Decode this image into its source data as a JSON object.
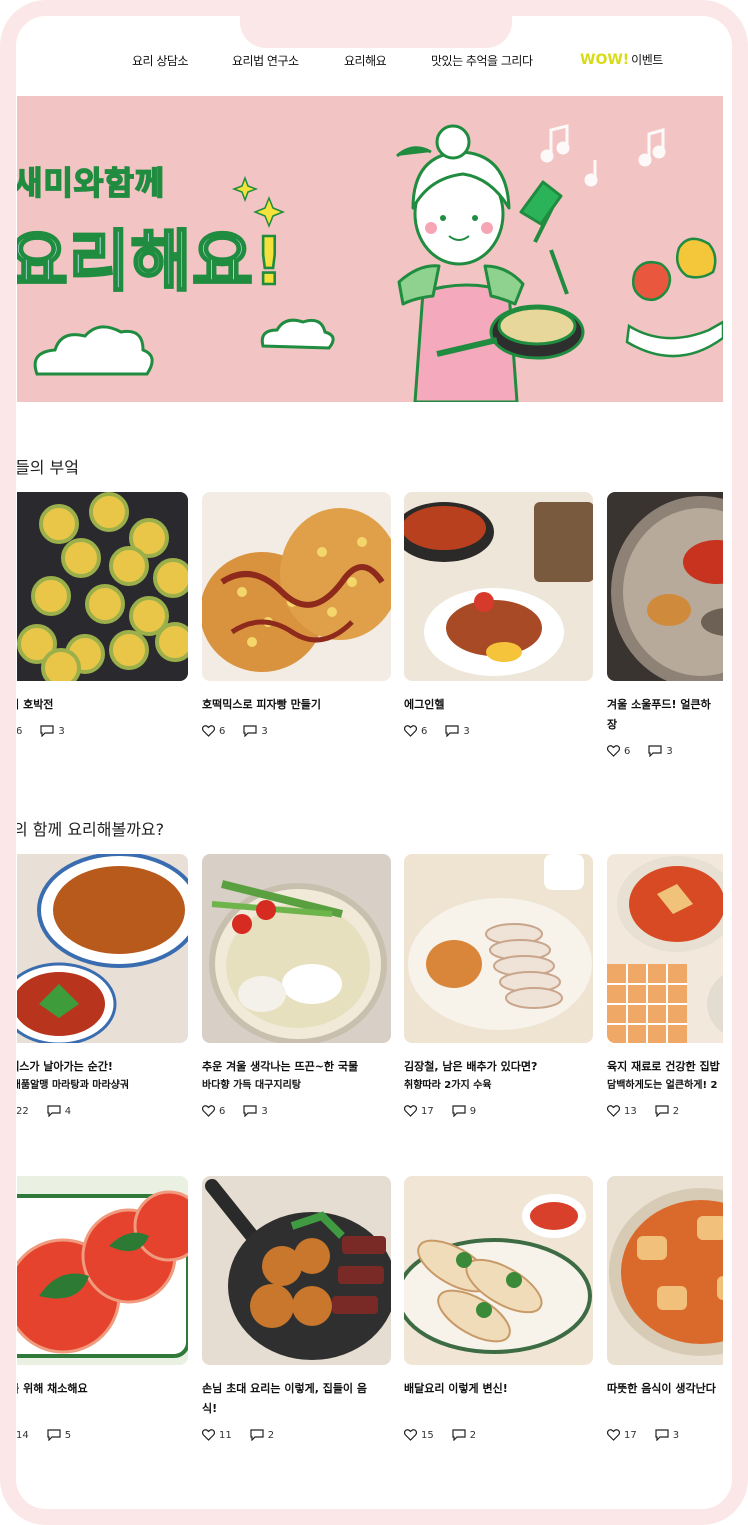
{
  "nav": {
    "items": [
      "요리 상담소",
      "요리법 연구소",
      "요리해요",
      "맛있는 추억을 그리다"
    ],
    "event_badge": "WOW!",
    "event_label": "이벤트"
  },
  "banner": {
    "line1": "새미와함께",
    "line2": "요리해요",
    "exclaim": "!"
  },
  "section1": {
    "title": "들의 부엌",
    "cards": [
      {
        "title": "들이 호박전",
        "likes": "6",
        "comments": "3",
        "image": "zucchini-pancake"
      },
      {
        "title": "호떡믹스로 피자빵 만들기",
        "likes": "6",
        "comments": "3",
        "image": "pizza-bread"
      },
      {
        "title": "에그인헬",
        "likes": "6",
        "comments": "3",
        "image": "egg-in-hell"
      },
      {
        "title": "겨울 소울푸드! 얼큰하",
        "title2": "장",
        "likes": "6",
        "comments": "3",
        "image": "soup-spices"
      }
    ]
  },
  "section2": {
    "title": "의 함께 요리해볼까요?",
    "cards": [
      {
        "title": "토메스가 날아가는 순간!",
        "sub": "은 배품알맹 마라탕과 마라샹궈",
        "likes": "22",
        "comments": "4",
        "image": "malatang"
      },
      {
        "title": "추운 겨울 생각나는 뜨끈~한 국물",
        "sub": "바다향 가득 대구지리탕",
        "likes": "6",
        "comments": "3",
        "image": "cod-soup"
      },
      {
        "title": "김장철, 남은 배추가 있다면?",
        "sub": "취향따라 2가지 수육",
        "likes": "17",
        "comments": "9",
        "image": "boiled-pork"
      },
      {
        "title": "육지 재료로 건강한 집밥",
        "sub": "담백하게도는 얼큰하게! 2",
        "likes": "13",
        "comments": "2",
        "image": "stew"
      }
    ]
  },
  "section3": {
    "cards": [
      {
        "title": "주를 위해 채소해요",
        "likes": "14",
        "comments": "5",
        "image": "tomato-salad"
      },
      {
        "title": "손님 초대 요리는 이렇게, 집들이 음",
        "title2": "식!",
        "likes": "11",
        "comments": "2",
        "image": "pan-roast"
      },
      {
        "title": "배달요리 이렇게 변신!",
        "likes": "15",
        "comments": "2",
        "image": "wraps"
      },
      {
        "title": "따뜻한 음식이 생각난다",
        "likes": "17",
        "comments": "3",
        "image": "braised-stew"
      }
    ]
  },
  "colors": {
    "frame": "#fbe7e7",
    "banner_bg": "#f3c4c4",
    "accent_green": "#1f8c3f",
    "wow_yellow": "#d8dc18"
  }
}
